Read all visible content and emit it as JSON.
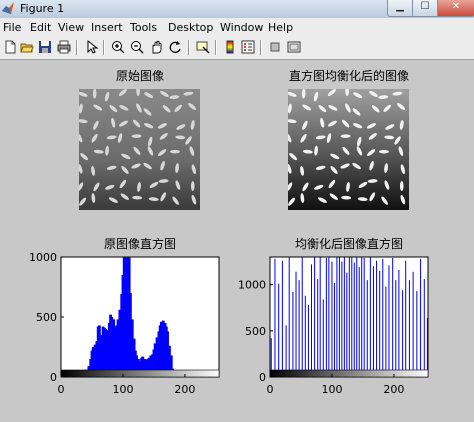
{
  "window": {
    "title": "Figure 1"
  },
  "menu": [
    "File",
    "Edit",
    "View",
    "Insert",
    "Tools",
    "Desktop",
    "Window",
    "Help"
  ],
  "toolbar": [
    "new-icon",
    "open-icon",
    "save-icon",
    "print-icon",
    "pointer-icon",
    "zoom-in-icon",
    "zoom-out-icon",
    "pan-icon",
    "rotate-icon",
    "data-cursor-icon",
    "colorbar-icon",
    "legend-icon",
    "hide-plot-tools-icon",
    "show-plot-tools-icon"
  ],
  "images": [
    {
      "title": "原始图像",
      "kind": "original"
    },
    {
      "title": "直方图均衡化后的图像",
      "kind": "equalized"
    }
  ],
  "chart_data": [
    {
      "type": "bar",
      "title": "原图像直方图",
      "xlim": [
        0,
        255
      ],
      "ylim": [
        0,
        1000
      ],
      "xticks": [
        0,
        100,
        200
      ],
      "yticks": [
        0,
        500,
        1000
      ],
      "color": "#0000ff",
      "x": [
        40,
        45,
        48,
        50,
        52,
        55,
        58,
        60,
        62,
        65,
        68,
        70,
        72,
        75,
        78,
        80,
        82,
        85,
        88,
        90,
        92,
        95,
        98,
        100,
        102,
        105,
        108,
        110,
        112,
        115,
        118,
        120,
        122,
        125,
        128,
        130,
        132,
        135,
        138,
        140,
        142,
        145,
        148,
        150,
        152,
        155,
        158,
        160,
        162,
        165,
        168,
        170,
        172,
        175,
        178,
        180,
        182,
        185,
        188
      ],
      "values": [
        60,
        90,
        150,
        220,
        250,
        270,
        300,
        420,
        430,
        350,
        420,
        410,
        400,
        390,
        450,
        520,
        500,
        480,
        420,
        430,
        480,
        560,
        690,
        850,
        1000,
        1000,
        1000,
        1000,
        700,
        480,
        320,
        220,
        180,
        150,
        130,
        160,
        170,
        150,
        140,
        150,
        160,
        180,
        190,
        230,
        280,
        330,
        380,
        430,
        460,
        470,
        450,
        420,
        380,
        260,
        180,
        70,
        40,
        15,
        5
      ]
    },
    {
      "type": "bar",
      "title": "均衡化后图像直方图",
      "xlim": [
        0,
        255
      ],
      "ylim": [
        0,
        1300
      ],
      "xticks": [
        0,
        100,
        200
      ],
      "yticks": [
        0,
        500,
        1000
      ],
      "color": "#0000ff",
      "x": [
        2,
        8,
        14,
        20,
        26,
        31,
        37,
        42,
        47,
        52,
        57,
        62,
        67,
        72,
        77,
        81,
        86,
        91,
        95,
        100,
        104,
        108,
        112,
        116,
        120,
        124,
        128,
        132,
        136,
        140,
        144,
        148,
        152,
        157,
        162,
        167,
        172,
        177,
        182,
        187,
        192,
        198,
        203,
        208,
        214,
        219,
        225,
        231,
        237,
        243,
        249,
        254
      ],
      "values": [
        420,
        1280,
        1010,
        1260,
        560,
        1300,
        920,
        1140,
        1050,
        1300,
        880,
        780,
        1220,
        1300,
        1060,
        1300,
        840,
        1290,
        1300,
        1250,
        1020,
        1300,
        1300,
        1250,
        1300,
        1130,
        1300,
        1300,
        1240,
        1300,
        1190,
        1300,
        1290,
        1050,
        1300,
        1200,
        1260,
        1150,
        1280,
        980,
        1210,
        1290,
        1050,
        1160,
        940,
        1260,
        1050,
        1140,
        930,
        1280,
        1060,
        640
      ]
    }
  ]
}
